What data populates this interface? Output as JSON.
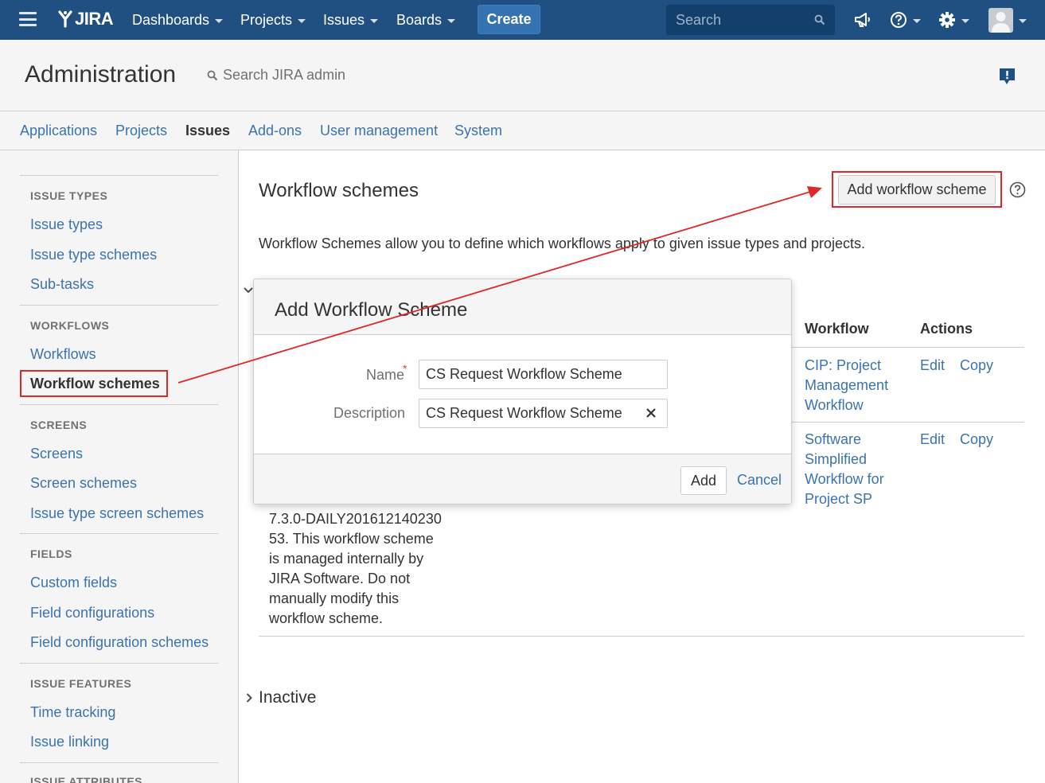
{
  "topbar": {
    "logo_text": "JIRA",
    "nav": [
      {
        "label": "Dashboards"
      },
      {
        "label": "Projects"
      },
      {
        "label": "Issues"
      },
      {
        "label": "Boards"
      }
    ],
    "create_label": "Create",
    "search_placeholder": "Search",
    "icons": [
      "menu-icon",
      "megaphone-icon",
      "help-icon",
      "gear-icon",
      "avatar"
    ]
  },
  "admin": {
    "title": "Administration",
    "search_label": "Search JIRA admin"
  },
  "tabs": [
    {
      "label": "Applications",
      "active": false
    },
    {
      "label": "Projects",
      "active": false
    },
    {
      "label": "Issues",
      "active": true
    },
    {
      "label": "Add-ons",
      "active": false
    },
    {
      "label": "User management",
      "active": false
    },
    {
      "label": "System",
      "active": false
    }
  ],
  "sidebar": {
    "sections": [
      {
        "heading": "ISSUE TYPES",
        "items": [
          "Issue types",
          "Issue type schemes",
          "Sub-tasks"
        ]
      },
      {
        "heading": "WORKFLOWS",
        "items": [
          "Workflows",
          "Workflow schemes"
        ]
      },
      {
        "heading": "SCREENS",
        "items": [
          "Screens",
          "Screen schemes",
          "Issue type screen schemes"
        ]
      },
      {
        "heading": "FIELDS",
        "items": [
          "Custom fields",
          "Field configurations",
          "Field configuration schemes"
        ]
      },
      {
        "heading": "ISSUE FEATURES",
        "items": [
          "Time tracking",
          "Issue linking"
        ]
      },
      {
        "heading": "ISSUE ATTRIBUTES",
        "items": []
      }
    ],
    "selected": "Workflow schemes"
  },
  "main": {
    "title": "Workflow schemes",
    "add_button": "Add workflow scheme",
    "description": "Workflow Schemes allow you to define which workflows apply to given issue types and projects.",
    "table": {
      "headers": {
        "workflow": "Workflow",
        "actions": "Actions"
      },
      "rows": [
        {
          "workflow_lines": [
            "CIP: Project",
            "Management",
            "Workflow"
          ],
          "edit": "Edit",
          "copy": "Copy"
        },
        {
          "workflow_lines": [
            "Software",
            "Simplified",
            "Workflow for",
            "Project SP"
          ],
          "edit": "Edit",
          "copy": "Copy"
        }
      ],
      "desc_fragment_lines": [
        "7.3.0-DAILY201612140230",
        "53. This workflow scheme",
        "is managed internally by",
        "JIRA Software. Do not",
        "manually modify this",
        "workflow scheme."
      ]
    },
    "inactive_label": "Inactive"
  },
  "modal": {
    "title": "Add Workflow Scheme",
    "name_label": "Name",
    "required_mark": "*",
    "name_value": "CS Request Workflow Scheme",
    "description_label": "Description",
    "description_value": "CS Request Workflow Scheme",
    "add_label": "Add",
    "cancel_label": "Cancel"
  },
  "colors": {
    "header_bg": "#205081",
    "link": "#3b73af",
    "annotation": "#e02626",
    "create_btn": "#3572b0"
  }
}
